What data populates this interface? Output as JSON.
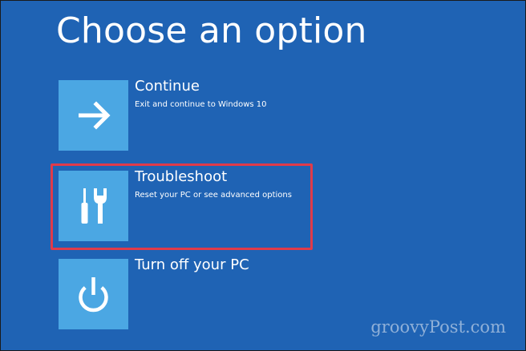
{
  "page": {
    "title": "Choose an option"
  },
  "options": [
    {
      "title": "Continue",
      "description": "Exit and continue to Windows 10",
      "icon": "arrow-right-icon"
    },
    {
      "title": "Troubleshoot",
      "description": "Reset your PC or see advanced options",
      "icon": "tools-icon",
      "highlighted": true
    },
    {
      "title": "Turn off your PC",
      "description": "",
      "icon": "power-icon"
    }
  ],
  "watermark": {
    "text": "groovyPost.com"
  },
  "colors": {
    "background": "#1f63b4",
    "tile": "#4ba7e3",
    "highlight_border": "#e03b4a",
    "text": "#ffffff"
  }
}
